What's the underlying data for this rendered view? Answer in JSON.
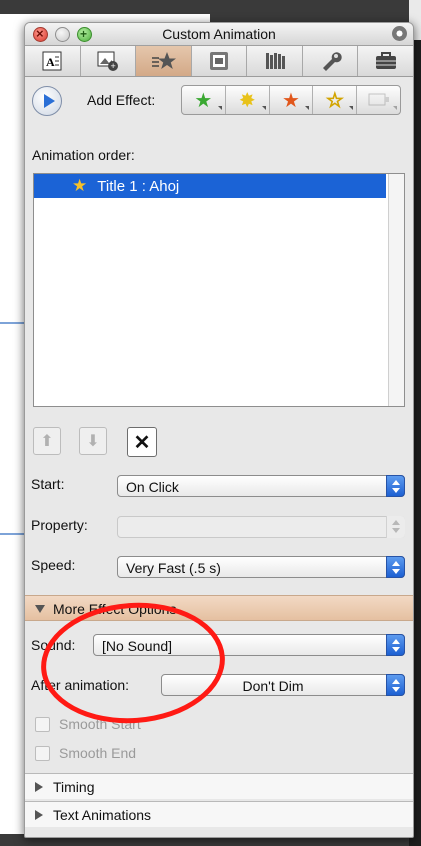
{
  "window": {
    "title": "Custom Animation"
  },
  "toolbar_tabs": [
    {
      "icon": "text-formatting-icon"
    },
    {
      "icon": "insert-image-icon"
    },
    {
      "icon": "custom-animation-icon"
    },
    {
      "icon": "scrapbook-icon"
    },
    {
      "icon": "reference-tools-icon"
    },
    {
      "icon": "wrench-icon"
    },
    {
      "icon": "toolbox-icon"
    }
  ],
  "add_effect": {
    "label": "Add Effect:",
    "buttons": [
      {
        "icon": "entrance-effect-icon",
        "color": "#3aa832"
      },
      {
        "icon": "emphasis-effect-icon",
        "color": "#e8c21a"
      },
      {
        "icon": "exit-effect-icon",
        "color": "#e1571c"
      },
      {
        "icon": "motion-path-icon",
        "color": "#d2a400"
      },
      {
        "icon": "action-effect-icon",
        "enabled": false
      }
    ]
  },
  "animation_order": {
    "label": "Animation order:",
    "items": [
      {
        "text": "Title 1 : Ahoj",
        "selected": true
      }
    ]
  },
  "controls": {
    "start": {
      "label": "Start:",
      "value": "On Click"
    },
    "property": {
      "label": "Property:",
      "value": ""
    },
    "speed": {
      "label": "Speed:",
      "value": "Very Fast (.5 s)"
    }
  },
  "more_effect_options": {
    "label": "More Effect Options",
    "sound": {
      "label": "Sound:",
      "value": "[No Sound]"
    },
    "after_animation": {
      "label": "After animation:",
      "value": "Don't Dim"
    },
    "smooth_start": {
      "label": "Smooth Start",
      "checked": false
    },
    "smooth_end": {
      "label": "Smooth End",
      "checked": false
    }
  },
  "sections": {
    "timing": "Timing",
    "text_animations": "Text Animations"
  },
  "colors": {
    "selection": "#1b63d6",
    "active_tab": "#d3a987",
    "annotation_circle": "#ff1a14"
  }
}
